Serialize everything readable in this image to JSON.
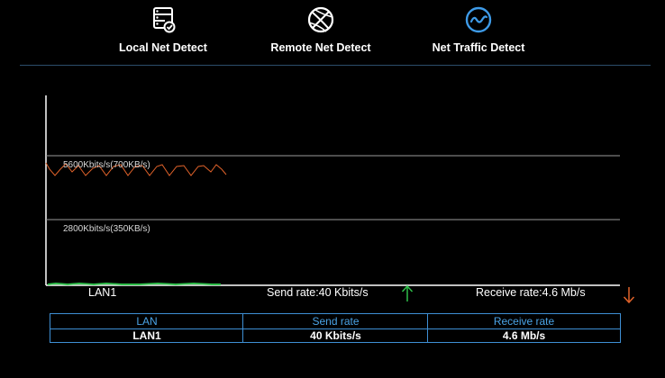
{
  "tabs": [
    {
      "label": "Local Net Detect",
      "icon": "local-net-icon",
      "active": false
    },
    {
      "label": "Remote Net Detect",
      "icon": "globe-icon",
      "active": false
    },
    {
      "label": "Net Traffic Detect",
      "icon": "traffic-wave-icon",
      "active": true
    }
  ],
  "graph": {
    "high_label": "5600Kbits/s(700KB/s)",
    "mid_label": "2800Kbits/s(350KB/s)",
    "lan_label": "LAN1",
    "send_rate_label": "Send rate:40 Kbits/s",
    "receive_rate_label": "Receive rate:4.6 Mb/s",
    "send_color": "#2fbf4a",
    "receive_color": "#e0622a"
  },
  "table": {
    "headers": [
      "LAN",
      "Send rate",
      "Receive rate"
    ],
    "rows": [
      [
        "LAN1",
        "40 Kbits/s",
        "4.6 Mb/s"
      ]
    ]
  },
  "colors": {
    "accent": "#3e8fd4",
    "background": "#000000"
  }
}
